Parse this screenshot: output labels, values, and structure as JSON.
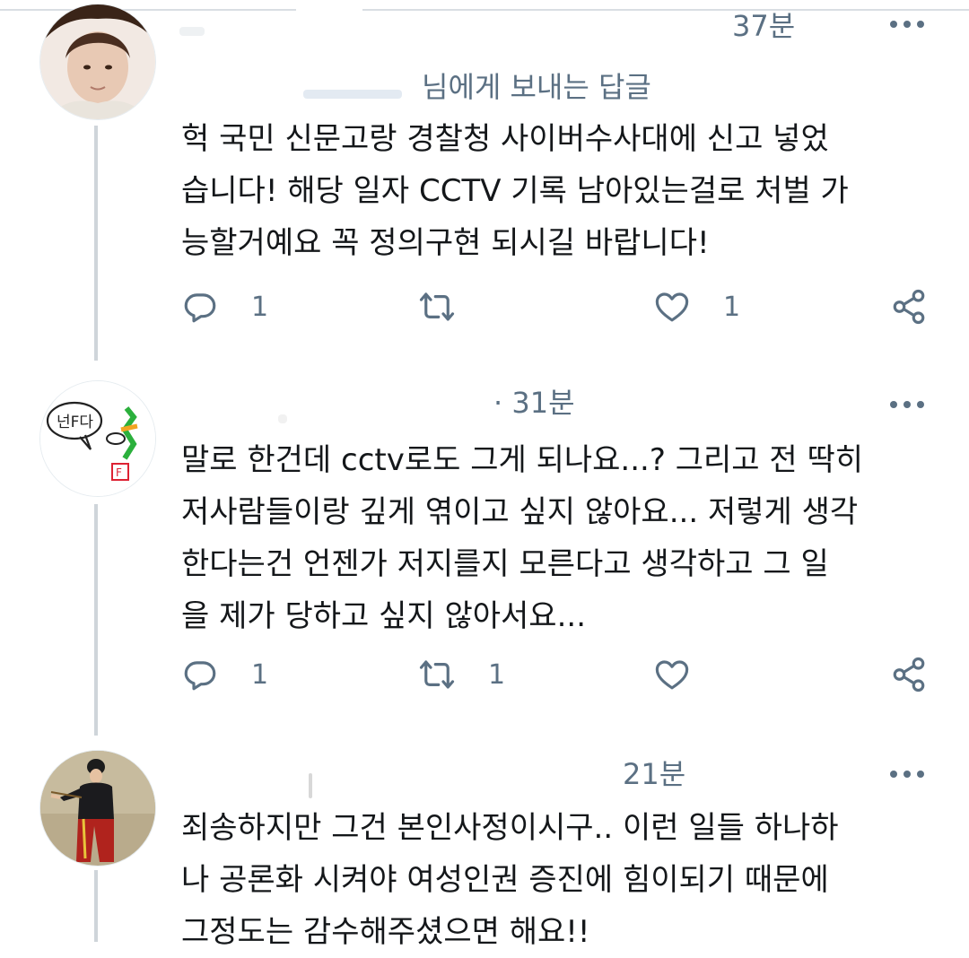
{
  "tweets": [
    {
      "time": "37분",
      "reply_to": "님에게 보내는 답글",
      "text": "헉 국민 신문고랑 경찰청 사이버수사대에 신고 넣었\n습니다! 해당 일자 CCTV 기록 남아있는걸로 처벌 가\n능할거예요 꼭 정의구현 되시길 바랍니다!",
      "reply_count": "1",
      "retweet_count": "",
      "like_count": "1"
    },
    {
      "time": "· 31분",
      "text": "말로 한건데 cctv로도 그게 되나요...? 그리고 전 딱히\n저사람들이랑 깊게 엮이고 싶지 않아요... 저렇게 생각\n한다는건 언젠가 저지를지 모른다고 생각하고 그 일\n을 제가 당하고 싶지 않아서요...",
      "reply_count": "1",
      "retweet_count": "1",
      "like_count": ""
    },
    {
      "time": "21분",
      "text": "죄송하지만 그건 본인사정이시구.. 이런 일들 하나하\n나 공론화 시켜야 여성인권 증진에 힘이되기 때문에\n그정도는 감수해주셨으면 해요!!"
    }
  ],
  "icons": {
    "reply": "reply-icon",
    "retweet": "retweet-icon",
    "like": "heart-icon",
    "share": "share-icon",
    "more": "more-icon"
  },
  "colors": {
    "text": "#14171a",
    "secondary": "#5b7083",
    "thread_line": "#cfd5da"
  }
}
